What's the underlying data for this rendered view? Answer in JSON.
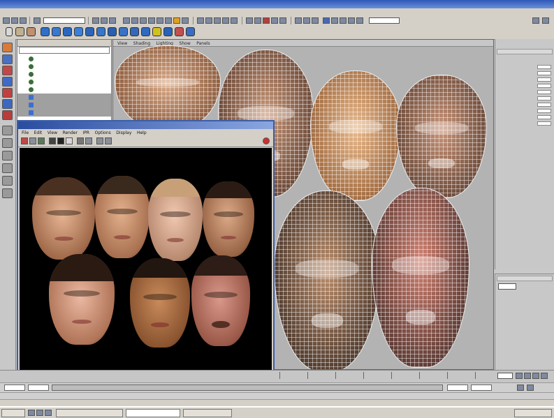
{
  "viewport": {
    "menus": [
      "View",
      "Shading",
      "Lighting",
      "Show",
      "Panels"
    ]
  },
  "render_view": {
    "menus": [
      "File",
      "Edit",
      "View",
      "Render",
      "IPR",
      "Options",
      "Display",
      "Help"
    ]
  },
  "colors": {
    "title_bar": "#2f58b8",
    "viewport_bg": "#b3b3b3",
    "render_canvas_bg": "#000000",
    "selection_row": "#a0a0a0",
    "face_skin_light": "#e2b796",
    "face_skin_dark": "#9a6644",
    "mesh_wire": "#ffffff"
  },
  "icons": [
    "select-tool",
    "lasso-tool",
    "move-tool",
    "rotate-tool",
    "scale-tool",
    "render-button",
    "ipr-button",
    "keep-image-button",
    "close-button"
  ]
}
